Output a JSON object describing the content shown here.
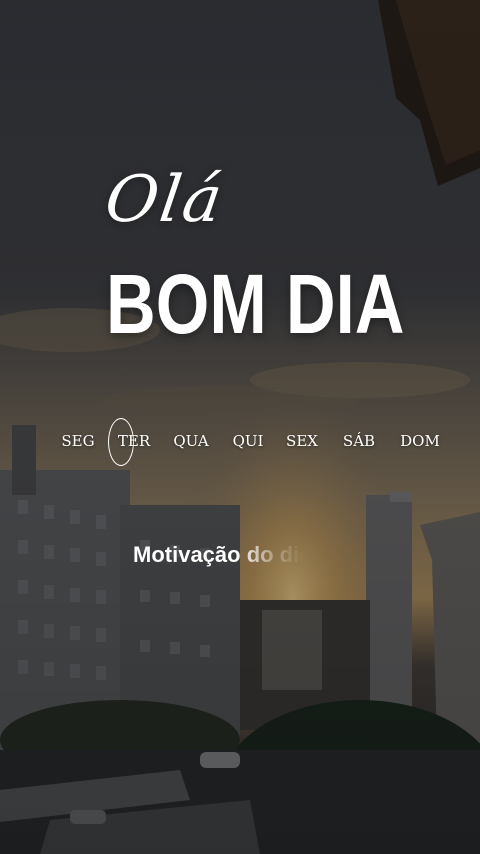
{
  "greeting": "Olá",
  "headline": "BOM DIA",
  "days": [
    {
      "label": "SEG",
      "selected": false
    },
    {
      "label": "TER",
      "selected": true
    },
    {
      "label": "QUA",
      "selected": false
    },
    {
      "label": "QUI",
      "selected": false
    },
    {
      "label": "SEX",
      "selected": false
    },
    {
      "label": "SÁB",
      "selected": false
    },
    {
      "label": "DOM",
      "selected": false
    }
  ],
  "motivation_text": "Motivação do dia",
  "colors": {
    "text": "#ffffff",
    "sky": "#3a3c42",
    "sunset": "#c9a266"
  }
}
